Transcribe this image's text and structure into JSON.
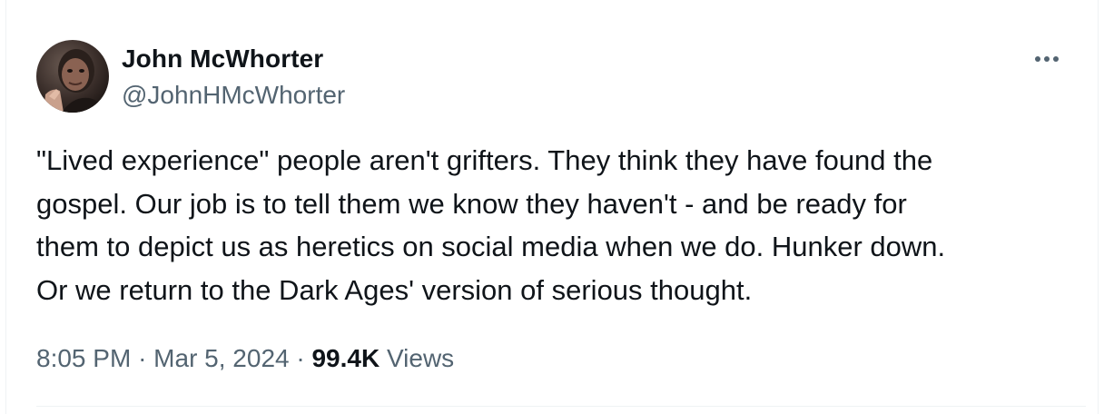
{
  "tweet": {
    "author": {
      "name": "John McWhorter",
      "handle": "@JohnHMcWhorter"
    },
    "text": "\"Lived experience\" people aren't grifters. They think they have found the\ngospel. Our job is to tell them we know they haven't - and be ready for\nthem to depict us as heretics on social media when we do. Hunker down.\nOr we return to the Dark Ages' version of serious thought.",
    "time": "8:05 PM",
    "separator": "·",
    "date": "Mar 5, 2024",
    "views_count": "99.4K",
    "views_label": "Views",
    "more_icon": "ellipsis-icon"
  },
  "colors": {
    "text_primary": "#0f1419",
    "text_secondary": "#536471",
    "divider": "#eff3f4",
    "background": "#ffffff"
  }
}
